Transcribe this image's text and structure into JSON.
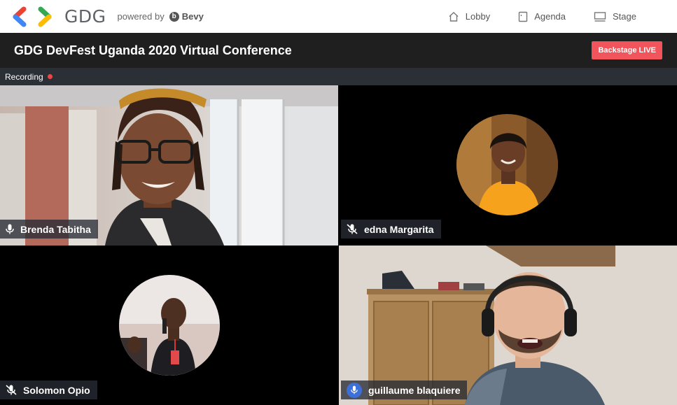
{
  "header": {
    "logo_text": "GDG",
    "powered_by": "powered by",
    "bevy": "Bevy",
    "nav": [
      {
        "label": "Lobby",
        "icon": "home-icon"
      },
      {
        "label": "Agenda",
        "icon": "agenda-icon"
      },
      {
        "label": "Stage",
        "icon": "stage-icon"
      }
    ]
  },
  "event": {
    "title": "GDG DevFest Uganda 2020 Virtual Conference",
    "backstage_label": "Backstage LIVE"
  },
  "recording": {
    "label": "Recording",
    "dot_color": "#e8474b"
  },
  "participants": [
    {
      "name": "Brenda Tabitha",
      "mic": "on"
    },
    {
      "name": "edna Margarita",
      "mic": "muted"
    },
    {
      "name": "Solomon Opio",
      "mic": "muted"
    },
    {
      "name": "guillaume blaquiere",
      "mic": "speaking"
    }
  ],
  "colors": {
    "title_bar": "#1f1f1f",
    "recording_bar": "#2b2f36",
    "backstage_button": "#f2545b",
    "active_mic": "#3d6fd9"
  }
}
